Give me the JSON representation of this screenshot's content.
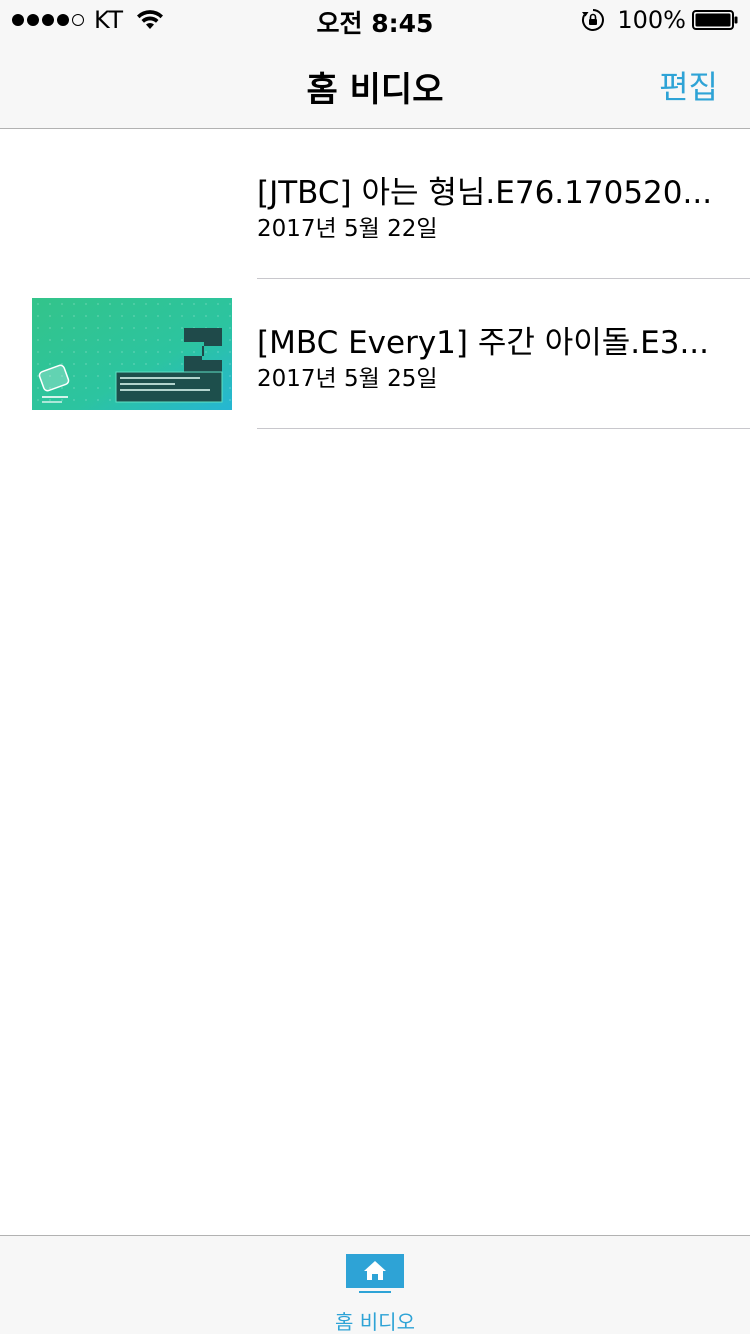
{
  "status_bar": {
    "carrier": "KT",
    "time": "오전 8:45",
    "battery_percent": "100%",
    "signal_bars_filled": 4,
    "signal_bars_total": 5
  },
  "nav": {
    "title": "홈 비디오",
    "edit_label": "편집"
  },
  "videos": [
    {
      "title": "[JTBC] 아는 형님.E76.170520...",
      "date": "2017년 5월 22일",
      "has_thumbnail": false
    },
    {
      "title": "[MBC Every1] 주간 아이돌.E3...",
      "date": "2017년 5월 25일",
      "has_thumbnail": true
    }
  ],
  "tab_bar": {
    "home_label": "홈 비디오",
    "home_icon": "home-icon",
    "selected": "home"
  },
  "colors": {
    "accent": "#2ea3d6",
    "bar_background": "#f7f7f7",
    "separator": "#c8c7cc"
  }
}
